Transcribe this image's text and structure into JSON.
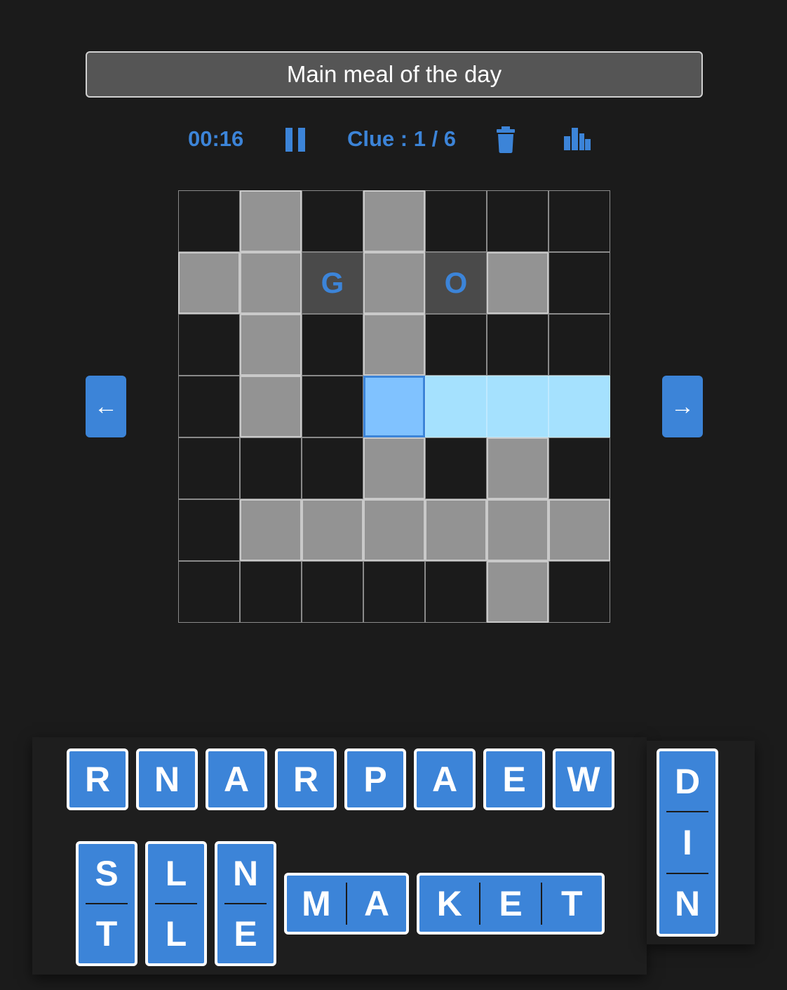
{
  "clue": {
    "text": "Main meal of the day"
  },
  "toolbar": {
    "timer": "00:16",
    "clue_counter": "Clue : 1 / 6",
    "pause_icon": "pause-icon",
    "trash_icon": "trash-icon",
    "stats_icon": "bar-chart-icon",
    "accent_color": "#3c84d8"
  },
  "nav": {
    "prev": "←",
    "next": "→"
  },
  "grid": {
    "rows": [
      [
        "",
        "g",
        "",
        "g",
        "",
        "",
        ""
      ],
      [
        "g",
        "g",
        "f",
        "g",
        "f",
        "g",
        ""
      ],
      [
        "",
        "g",
        "",
        "g",
        "",
        "",
        ""
      ],
      [
        "",
        "g",
        "",
        "s",
        "h",
        "h",
        "h"
      ],
      [
        "",
        "",
        "",
        "g",
        "",
        "g",
        ""
      ],
      [
        "",
        "g",
        "g",
        "g",
        "g",
        "g",
        "g"
      ],
      [
        "",
        "",
        "",
        "",
        "",
        "g",
        ""
      ]
    ],
    "letters": [
      [
        "",
        "",
        "",
        "",
        "",
        "",
        ""
      ],
      [
        "",
        "",
        "G",
        "",
        "O",
        "",
        ""
      ],
      [
        "",
        "",
        "",
        "",
        "",
        "",
        ""
      ],
      [
        "",
        "",
        "",
        "",
        "",
        "",
        ""
      ],
      [
        "",
        "",
        "",
        "",
        "",
        "",
        ""
      ],
      [
        "",
        "",
        "",
        "",
        "",
        "",
        ""
      ],
      [
        "",
        "",
        "",
        "",
        "",
        "",
        ""
      ]
    ],
    "colors": {
      "empty": "#1b1b1b",
      "word": "#939393",
      "filled": "#4a4a4a",
      "selected": "#80c2ff",
      "highlight": "#a5e1fe"
    }
  },
  "tiles": [
    {
      "letters": [
        "R"
      ],
      "orientation": "h"
    },
    {
      "letters": [
        "N"
      ],
      "orientation": "h"
    },
    {
      "letters": [
        "A"
      ],
      "orientation": "h"
    },
    {
      "letters": [
        "R"
      ],
      "orientation": "h"
    },
    {
      "letters": [
        "P"
      ],
      "orientation": "h"
    },
    {
      "letters": [
        "A"
      ],
      "orientation": "h"
    },
    {
      "letters": [
        "E"
      ],
      "orientation": "h"
    },
    {
      "letters": [
        "W"
      ],
      "orientation": "h"
    },
    {
      "letters": [
        "D",
        "I",
        "N"
      ],
      "orientation": "v"
    },
    {
      "letters": [
        "S",
        "T"
      ],
      "orientation": "v"
    },
    {
      "letters": [
        "L",
        "L"
      ],
      "orientation": "v"
    },
    {
      "letters": [
        "N",
        "E"
      ],
      "orientation": "v"
    },
    {
      "letters": [
        "M",
        "A"
      ],
      "orientation": "h"
    },
    {
      "letters": [
        "K",
        "E",
        "T"
      ],
      "orientation": "h"
    }
  ]
}
